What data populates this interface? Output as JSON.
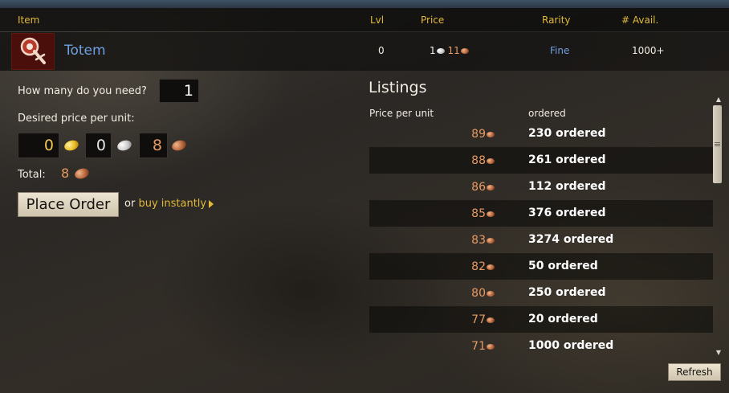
{
  "header": {
    "item": "Item",
    "level": "Lvl",
    "price": "Price",
    "rarity": "Rarity",
    "available": "# Avail."
  },
  "item": {
    "icon": "totem-item-icon",
    "name": "Totem",
    "level": "0",
    "price_silver": "1",
    "price_copper": "11",
    "rarity": "Fine",
    "available": "1000+"
  },
  "order_form": {
    "quantity_label": "How many do you need?",
    "quantity_value": "1",
    "price_label": "Desired price per unit:",
    "gold": "0",
    "silver": "0",
    "copper": "8",
    "total_label": "Total:",
    "total_value": "8",
    "place_order": "Place Order",
    "or_text": "or",
    "buy_instantly": "buy instantly"
  },
  "listings": {
    "title": "Listings",
    "col_price": "Price per unit",
    "col_ordered": "ordered",
    "rows": [
      {
        "price": "89",
        "ordered": "230 ordered"
      },
      {
        "price": "88",
        "ordered": "261 ordered"
      },
      {
        "price": "86",
        "ordered": "112 ordered"
      },
      {
        "price": "85",
        "ordered": "376 ordered"
      },
      {
        "price": "83",
        "ordered": "3274 ordered"
      },
      {
        "price": "82",
        "ordered": "50 ordered"
      },
      {
        "price": "80",
        "ordered": "250 ordered"
      },
      {
        "price": "77",
        "ordered": "20 ordered"
      },
      {
        "price": "71",
        "ordered": "1000 ordered"
      }
    ]
  },
  "refresh_label": "Refresh",
  "colors": {
    "header_text": "#e2b93a",
    "item_name": "#6f9fe0",
    "copper_text": "#e79a62"
  }
}
